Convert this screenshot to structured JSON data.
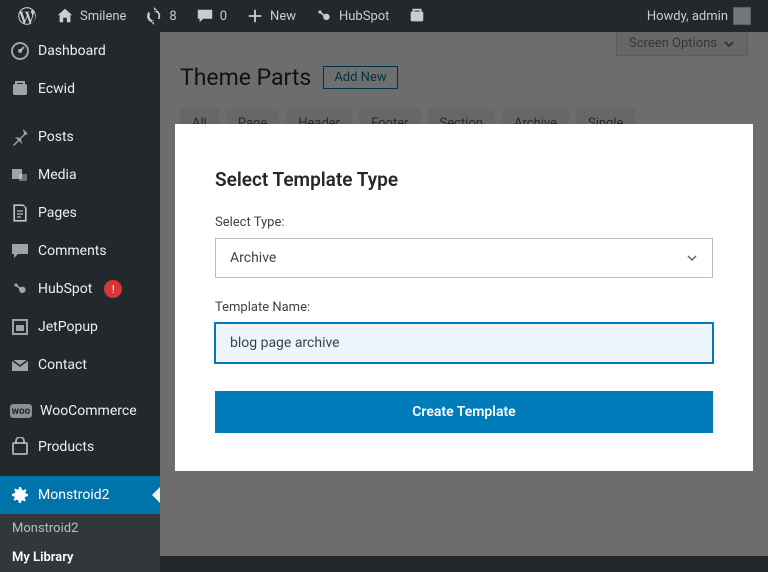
{
  "topbar": {
    "site": "Smilene",
    "updates": "8",
    "comments": "0",
    "new": "New",
    "hubspot": "HubSpot",
    "greeting": "Howdy, admin"
  },
  "sidebar": {
    "items": [
      {
        "label": "Dashboard"
      },
      {
        "label": "Ecwid"
      },
      {
        "label": "Posts"
      },
      {
        "label": "Media"
      },
      {
        "label": "Pages"
      },
      {
        "label": "Comments"
      },
      {
        "label": "HubSpot",
        "badge": "!"
      },
      {
        "label": "JetPopup"
      },
      {
        "label": "Contact"
      },
      {
        "label": "WooCommerce"
      },
      {
        "label": "Products"
      },
      {
        "label": "Monstroid2"
      }
    ],
    "submenu": [
      {
        "label": "Monstroid2"
      },
      {
        "label": "My Library"
      }
    ]
  },
  "content": {
    "screen_options": "Screen Options",
    "title": "Theme Parts",
    "add_new": "Add New",
    "tabs": [
      "All",
      "Page",
      "Header",
      "Footer",
      "Section",
      "Archive",
      "Single"
    ]
  },
  "modal": {
    "title": "Select Template Type",
    "type_label": "Select Type:",
    "type_value": "Archive",
    "name_label": "Template Name:",
    "name_value": "blog page archive",
    "submit": "Create Template"
  }
}
